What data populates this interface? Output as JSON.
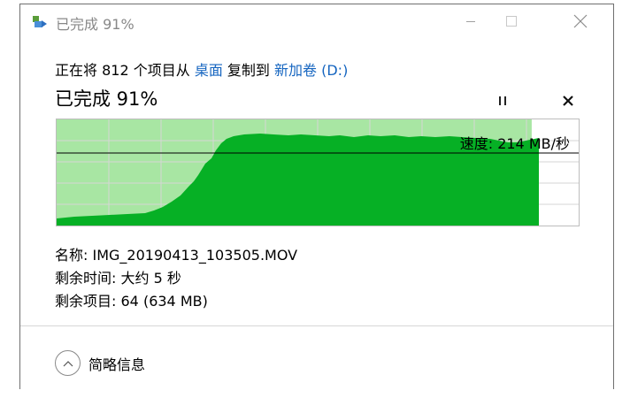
{
  "window": {
    "title": "已完成 91%"
  },
  "copy": {
    "prefix": "正在将 812 个项目从",
    "source": "桌面",
    "middle": "复制到",
    "destination": "新加卷 (D:)"
  },
  "progress": {
    "title": "已完成 91%",
    "percent": 91,
    "speed": "速度: 214 MB/秒"
  },
  "info": {
    "name_label": "名称:",
    "name_value": "IMG_20190413_103505.MOV",
    "time_label": "剩余时间:",
    "time_value": "大约 5 秒",
    "items_label": "剩余项目:",
    "items_value": "64 (634 MB)"
  },
  "footer": {
    "details_label": "简略信息"
  },
  "colors": {
    "graph_fill": "#06b025",
    "graph_progress_bg": "#a8e6a3",
    "graph_grid": "#d6d6d6",
    "link": "#1565c0"
  },
  "icons": {
    "app": "copy-transfer-icon",
    "pause": "pause-icon",
    "cancel": "close-icon",
    "collapse": "chevron-up-icon"
  }
}
